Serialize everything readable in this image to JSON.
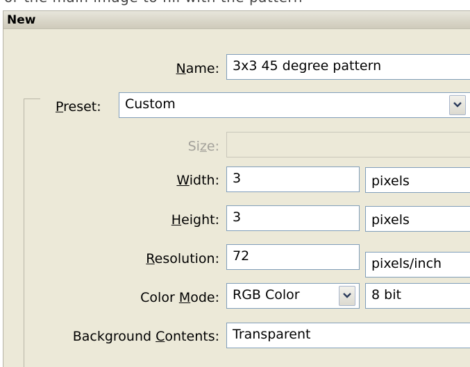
{
  "dialog": {
    "title": "New"
  },
  "top_strip": {
    "text": "or the main image to fill with the pattern"
  },
  "form": {
    "name_label_pre": "",
    "name_label_key": "N",
    "name_label_post": "ame:",
    "name_value": "3x3 45 degree pattern",
    "preset_label_key": "P",
    "preset_label_post": "reset:",
    "preset_value": "Custom",
    "size_label_pre": "Si",
    "size_label_key": "z",
    "size_label_post": "e:",
    "size_value": "",
    "width_label_key": "W",
    "width_label_post": "idth:",
    "width_value": "3",
    "width_unit": "pixels",
    "height_label_key": "H",
    "height_label_post": "eight:",
    "height_value": "3",
    "height_unit": "pixels",
    "resolution_label_key": "R",
    "resolution_label_post": "esolution:",
    "resolution_value": "72",
    "resolution_unit": "pixels/inch",
    "color_mode_label_pre": "Color ",
    "color_mode_label_key": "M",
    "color_mode_label_post": "ode:",
    "color_mode_value": "RGB Color",
    "bit_depth_value": "8 bit",
    "background_label_pre": "Background ",
    "background_label_key": "C",
    "background_label_post": "ontents:",
    "background_value": "Transparent"
  },
  "icons": {
    "dropdown": "chevron-down-icon"
  },
  "colors": {
    "dialog_bg": "#ece9d8",
    "field_border": "#7f9db9"
  }
}
